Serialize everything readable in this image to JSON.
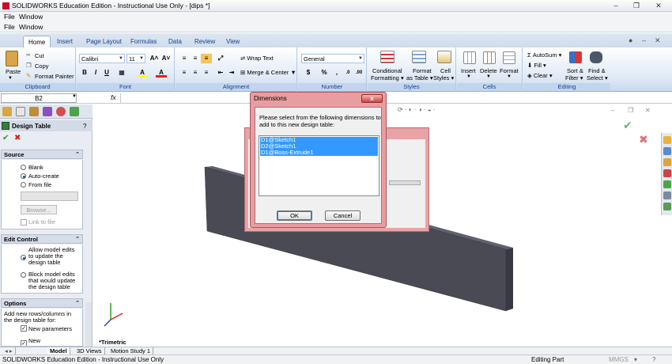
{
  "titlebar": {
    "title": "SOLIDWORKS Education Edition - Instructional Use Only - [dips *]",
    "minimize": "–",
    "restore": "❐",
    "close": "✕"
  },
  "menus": {
    "row1": [
      "File",
      "Window"
    ],
    "row2": [
      "File",
      "Window"
    ]
  },
  "ribbon": {
    "tabs": [
      "Home",
      "Insert",
      "Page Layout",
      "Formulas",
      "Data",
      "Review",
      "View"
    ],
    "active_tab": "Home",
    "clipboard": {
      "paste": "Paste",
      "cut": "Cut",
      "copy": "Copy",
      "format_painter": "Format Painter",
      "label": "Clipboard"
    },
    "font": {
      "name": "Calibri",
      "size": "11",
      "grow": "A˄",
      "shrink": "A˅",
      "bold": "B",
      "italic": "I",
      "underline": "U",
      "fill": "A",
      "color": "A",
      "label": "Font"
    },
    "alignment": {
      "wrap_text": "Wrap Text",
      "merge_center": "Merge & Center",
      "label": "Alignment"
    },
    "number": {
      "format": "General",
      "currency": "$",
      "percent": "%",
      "comma": ",",
      "label": "Number"
    },
    "styles": {
      "conditional_1": "Conditional",
      "conditional_2": "Formatting",
      "format_table_1": "Format",
      "format_table_2": "as Table",
      "cell_styles_1": "Cell",
      "cell_styles_2": "Styles",
      "label": "Styles"
    },
    "cells": {
      "insert": "Insert",
      "delete": "Delete",
      "format": "Format",
      "label": "Cells"
    },
    "editing": {
      "autosum": "AutoSum",
      "fill": "Fill",
      "clear": "Clear",
      "sort_1": "Sort &",
      "sort_2": "Filter",
      "find_1": "Find &",
      "find_2": "Select",
      "label": "Editing"
    }
  },
  "formula_bar": {
    "name_box": "B2",
    "fx": "fx"
  },
  "property_manager": {
    "title": "Design Table",
    "help": "?",
    "ok": "✔",
    "cancel": "✖",
    "source": {
      "header": "Source",
      "blank": "Blank",
      "auto_create": "Auto-create",
      "from_file": "From file",
      "browse": "Browse...",
      "link_to_file": "Link to file"
    },
    "edit_control": {
      "header": "Edit Control",
      "allow_1": "Allow model edits",
      "allow_2": "to update the",
      "allow_3": "design table",
      "block_1": "Block model edits",
      "block_2": "that would update",
      "block_3": "the design table"
    },
    "options": {
      "header": "Options",
      "desc_1": "Add new rows/columns in",
      "desc_2": "the design table for:",
      "new_parameters": "New parameters",
      "new": "New"
    }
  },
  "graphics": {
    "view_label": "*Trimetric"
  },
  "sheet_tabs": [
    "Model",
    "3D Views",
    "Motion Study 1"
  ],
  "status": {
    "left": "SOLIDWORKS Education Edition - Instructional Use Only",
    "editing": "Editing Part",
    "units": "MMGS"
  },
  "dialog": {
    "title": "Dimensions",
    "prompt": "Please select from the following dimensions to add to this new design table:",
    "items": [
      "D1@Sketch1",
      "D2@Sketch1",
      "D1@Boss-Extrude1"
    ],
    "ok": "OK",
    "cancel": "Cancel",
    "close": "x"
  },
  "colors": {
    "dialog_frame": "#e99da1",
    "selection": "#3399ff",
    "ribbon_blue": "#15428b",
    "part_face": "#4a4a55"
  }
}
